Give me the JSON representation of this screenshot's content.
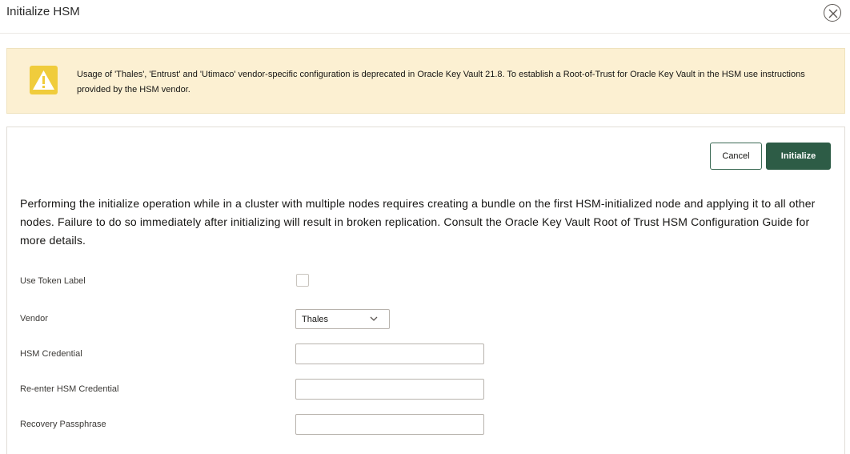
{
  "dialog": {
    "title": "Initialize HSM",
    "close_icon": "close-circle-icon"
  },
  "warning": {
    "icon": "warning-triangle-icon",
    "message": "Usage of 'Thales', 'Entrust' and 'Utimaco' vendor-specific configuration is deprecated in Oracle Key Vault 21.8. To establish a Root-of-Trust for Oracle Key Vault in the HSM use instructions provided by the HSM vendor."
  },
  "actions": {
    "cancel_label": "Cancel",
    "initialize_label": "Initialize"
  },
  "info_text": "Performing the initialize operation while in a cluster with multiple nodes requires creating a bundle on the first HSM-initialized node and applying it to all other nodes. Failure to do so immediately after initializing will result in broken replication. Consult the Oracle Key Vault Root of Trust HSM Configuration Guide for more details.",
  "form": {
    "use_token_label": {
      "label": "Use Token Label",
      "checked": false
    },
    "vendor": {
      "label": "Vendor",
      "value": "Thales"
    },
    "hsm_credential": {
      "label": "HSM Credential",
      "value": ""
    },
    "reenter_hsm_credential": {
      "label": "Re-enter HSM Credential",
      "value": ""
    },
    "recovery_passphrase": {
      "label": "Recovery Passphrase",
      "value": ""
    }
  },
  "colors": {
    "primary": "#2d5c46",
    "warning_bg": "#fcf0d2",
    "warning_icon": "#f0cc3c"
  }
}
